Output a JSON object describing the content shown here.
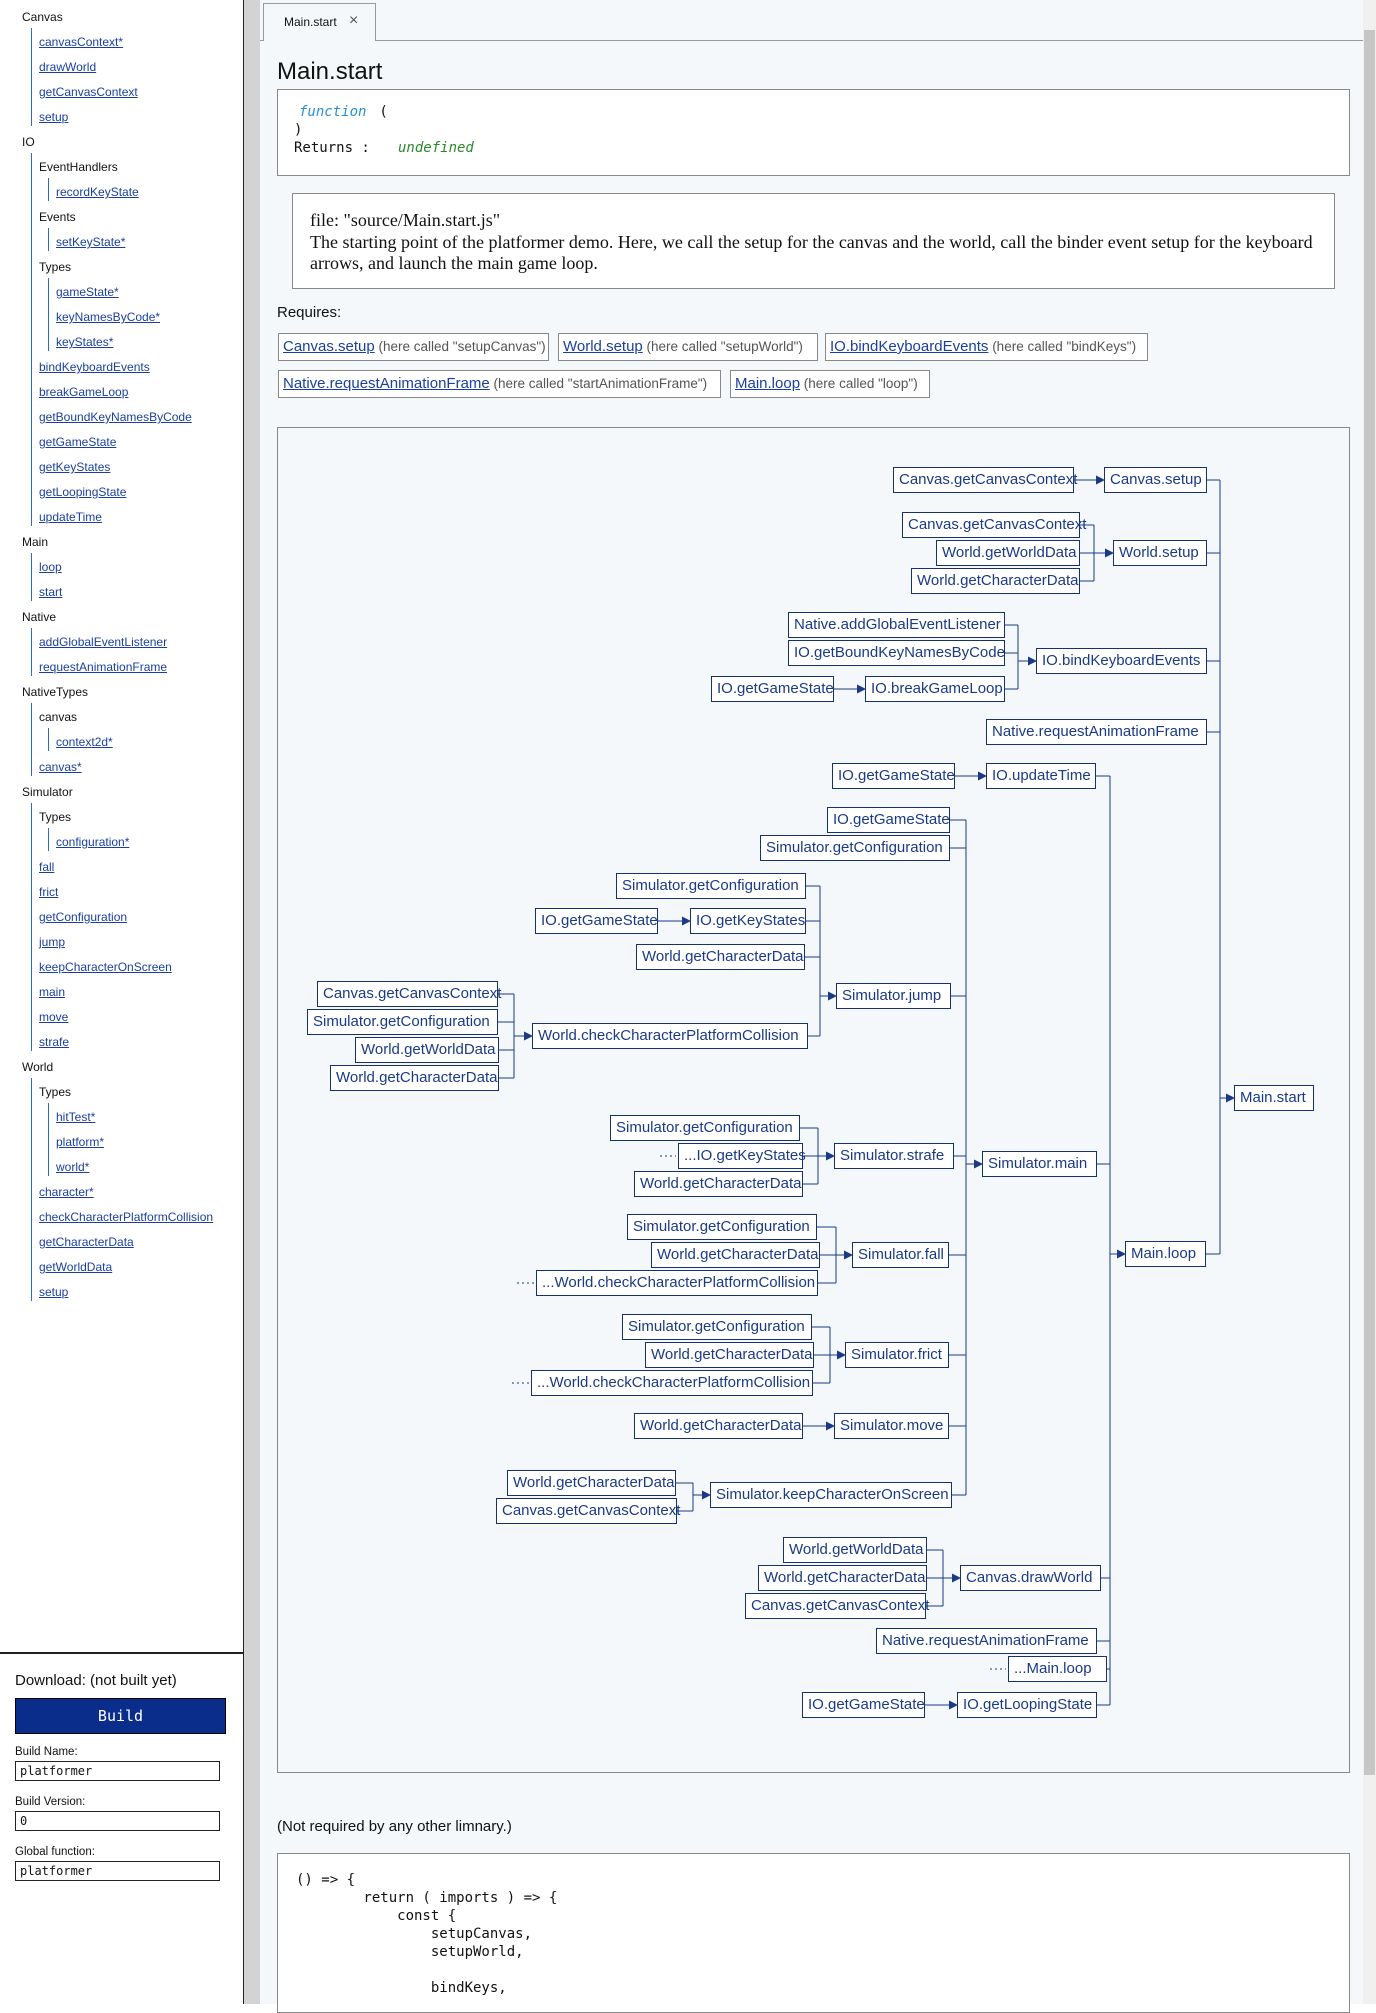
{
  "sidebar": {
    "items": [
      {
        "t": "Canvas",
        "d": 0,
        "l": false
      },
      {
        "t": "canvasContext*",
        "d": 1,
        "l": true
      },
      {
        "t": "drawWorld",
        "d": 1,
        "l": true
      },
      {
        "t": "getCanvasContext",
        "d": 1,
        "l": true
      },
      {
        "t": "setup",
        "d": 1,
        "l": true
      },
      {
        "t": "IO",
        "d": 0,
        "l": false
      },
      {
        "t": "EventHandlers",
        "d": 1,
        "l": false
      },
      {
        "t": "recordKeyState",
        "d": 2,
        "l": true
      },
      {
        "t": "Events",
        "d": 1,
        "l": false
      },
      {
        "t": "setKeyState*",
        "d": 2,
        "l": true
      },
      {
        "t": "Types",
        "d": 1,
        "l": false
      },
      {
        "t": "gameState*",
        "d": 2,
        "l": true
      },
      {
        "t": "keyNamesByCode*",
        "d": 2,
        "l": true
      },
      {
        "t": "keyStates*",
        "d": 2,
        "l": true
      },
      {
        "t": "bindKeyboardEvents",
        "d": 1,
        "l": true
      },
      {
        "t": "breakGameLoop",
        "d": 1,
        "l": true
      },
      {
        "t": "getBoundKeyNamesByCode",
        "d": 1,
        "l": true
      },
      {
        "t": "getGameState",
        "d": 1,
        "l": true
      },
      {
        "t": "getKeyStates",
        "d": 1,
        "l": true
      },
      {
        "t": "getLoopingState",
        "d": 1,
        "l": true
      },
      {
        "t": "updateTime",
        "d": 1,
        "l": true
      },
      {
        "t": "Main",
        "d": 0,
        "l": false
      },
      {
        "t": "loop",
        "d": 1,
        "l": true
      },
      {
        "t": "start",
        "d": 1,
        "l": true
      },
      {
        "t": "Native",
        "d": 0,
        "l": false
      },
      {
        "t": "addGlobalEventListener",
        "d": 1,
        "l": true
      },
      {
        "t": "requestAnimationFrame",
        "d": 1,
        "l": true
      },
      {
        "t": "NativeTypes",
        "d": 0,
        "l": false
      },
      {
        "t": "canvas",
        "d": 1,
        "l": false
      },
      {
        "t": "context2d*",
        "d": 2,
        "l": true
      },
      {
        "t": "canvas*",
        "d": 1,
        "l": true
      },
      {
        "t": "Simulator",
        "d": 0,
        "l": false
      },
      {
        "t": "Types",
        "d": 1,
        "l": false
      },
      {
        "t": "configuration*",
        "d": 2,
        "l": true
      },
      {
        "t": "fall",
        "d": 1,
        "l": true
      },
      {
        "t": "frict",
        "d": 1,
        "l": true
      },
      {
        "t": "getConfiguration",
        "d": 1,
        "l": true
      },
      {
        "t": "jump",
        "d": 1,
        "l": true
      },
      {
        "t": "keepCharacterOnScreen",
        "d": 1,
        "l": true
      },
      {
        "t": "main",
        "d": 1,
        "l": true
      },
      {
        "t": "move",
        "d": 1,
        "l": true
      },
      {
        "t": "strafe",
        "d": 1,
        "l": true
      },
      {
        "t": "World",
        "d": 0,
        "l": false
      },
      {
        "t": "Types",
        "d": 1,
        "l": false
      },
      {
        "t": "hitTest*",
        "d": 2,
        "l": true
      },
      {
        "t": "platform*",
        "d": 2,
        "l": true
      },
      {
        "t": "world*",
        "d": 2,
        "l": true
      },
      {
        "t": "character*",
        "d": 1,
        "l": true
      },
      {
        "t": "checkCharacterPlatformCollision",
        "d": 1,
        "l": true
      },
      {
        "t": "getCharacterData",
        "d": 1,
        "l": true
      },
      {
        "t": "getWorldData",
        "d": 1,
        "l": true
      },
      {
        "t": "setup",
        "d": 1,
        "l": true
      }
    ]
  },
  "build": {
    "download_label": "Download: (not built yet)",
    "build_button": "Build",
    "name_label": "Build Name:",
    "name_value": "platformer",
    "version_label": "Build Version:",
    "version_value": "0",
    "global_label": "Global function:",
    "global_value": "platformer"
  },
  "tab": {
    "label": "Main.start",
    "close": "×"
  },
  "page": {
    "title": "Main.start"
  },
  "signature": {
    "keyword": "function",
    "open": " (",
    "close": ")",
    "returns_label": "Returns :",
    "returns_type": "undefined"
  },
  "description": {
    "file": "file: \"source/Main.start.js\"",
    "text": "The starting point of the platformer demo. Here, we call the setup for the canvas and the world, call the binder event setup for the keyboard arrows, and launch the main game loop."
  },
  "requires": {
    "label": "Requires:",
    "items": [
      {
        "name": "Canvas.setup",
        "alias": "(here called \"setupCanvas\")"
      },
      {
        "name": "World.setup",
        "alias": "(here called \"setupWorld\")"
      },
      {
        "name": "IO.bindKeyboardEvents",
        "alias": "(here called \"bindKeys\")"
      },
      {
        "name": "Native.requestAnimationFrame",
        "alias": "(here called \"startAnimationFrame\")"
      },
      {
        "name": "Main.loop",
        "alias": "(here called \"loop\")"
      }
    ]
  },
  "graph_labels": {
    "cgcc1": "Canvas.getCanvasContext",
    "csetup": "Canvas.setup",
    "cgcc2": "Canvas.getCanvasContext",
    "wgwd1": "World.getWorldData",
    "wgcd1": "World.getCharacterData",
    "wsetup": "World.setup",
    "nagel": "Native.addGlobalEventListener",
    "iogbk": "IO.getBoundKeyNamesByCode",
    "iogs1": "IO.getGameState",
    "iobgl": "IO.breakGameLoop",
    "iobke": "IO.bindKeyboardEvents",
    "nraf1": "Native.requestAnimationFrame",
    "iogs2": "IO.getGameState",
    "ioupd": "IO.updateTime",
    "iogs3": "IO.getGameState",
    "sgc1": "Simulator.getConfiguration",
    "sgc2": "Simulator.getConfiguration",
    "iogs4": "IO.getGameState",
    "iogks1": "IO.getKeyStates",
    "wgcd2": "World.getCharacterData",
    "cgcc3": "Canvas.getCanvasContext",
    "sgc3": "Simulator.getConfiguration",
    "wgwd2": "World.getWorldData",
    "wgcd3": "World.getCharacterData",
    "wccpc": "World.checkCharacterPlatformCollision",
    "sjump": "Simulator.jump",
    "mstart": "Main.start",
    "sgc4": "Simulator.getConfiguration",
    "iogks2": "...IO.getKeyStates",
    "wgcd4": "World.getCharacterData",
    "sstrafe": "Simulator.strafe",
    "smain": "Simulator.main",
    "sgc5": "Simulator.getConfiguration",
    "wgcd5": "World.getCharacterData",
    "wccpc2": "...World.checkCharacterPlatformCollision",
    "sfall": "Simulator.fall",
    "mloop": "Main.loop",
    "sgc6": "Simulator.getConfiguration",
    "wgcd6": "World.getCharacterData",
    "wccpc3": "...World.checkCharacterPlatformCollision",
    "sfrict": "Simulator.frict",
    "wgcd7": "World.getCharacterData",
    "smove": "Simulator.move",
    "wgcd8": "World.getCharacterData",
    "cgcc4": "Canvas.getCanvasContext",
    "skcos": "Simulator.keepCharacterOnScreen",
    "wgwd3": "World.getWorldData",
    "wgcd9": "World.getCharacterData",
    "cgcc5": "Canvas.getCanvasContext",
    "cdraw": "Canvas.drawWorld",
    "nraf2": "Native.requestAnimationFrame",
    "mloop2": "...Main.loop",
    "iogs5": "IO.getGameState",
    "iogls": "IO.getLoopingState"
  },
  "not_required": "(Not required by any other limnary.)",
  "code": "() => {\n        return ( imports ) => {\n            const {\n                setupCanvas,\n                setupWorld,\n\n                bindKeys,",
  "colors": {
    "accent": "#0a2c8a",
    "link": "#1a3fa0",
    "node_border": "#17306f",
    "graph_line": "#1a3a85"
  }
}
